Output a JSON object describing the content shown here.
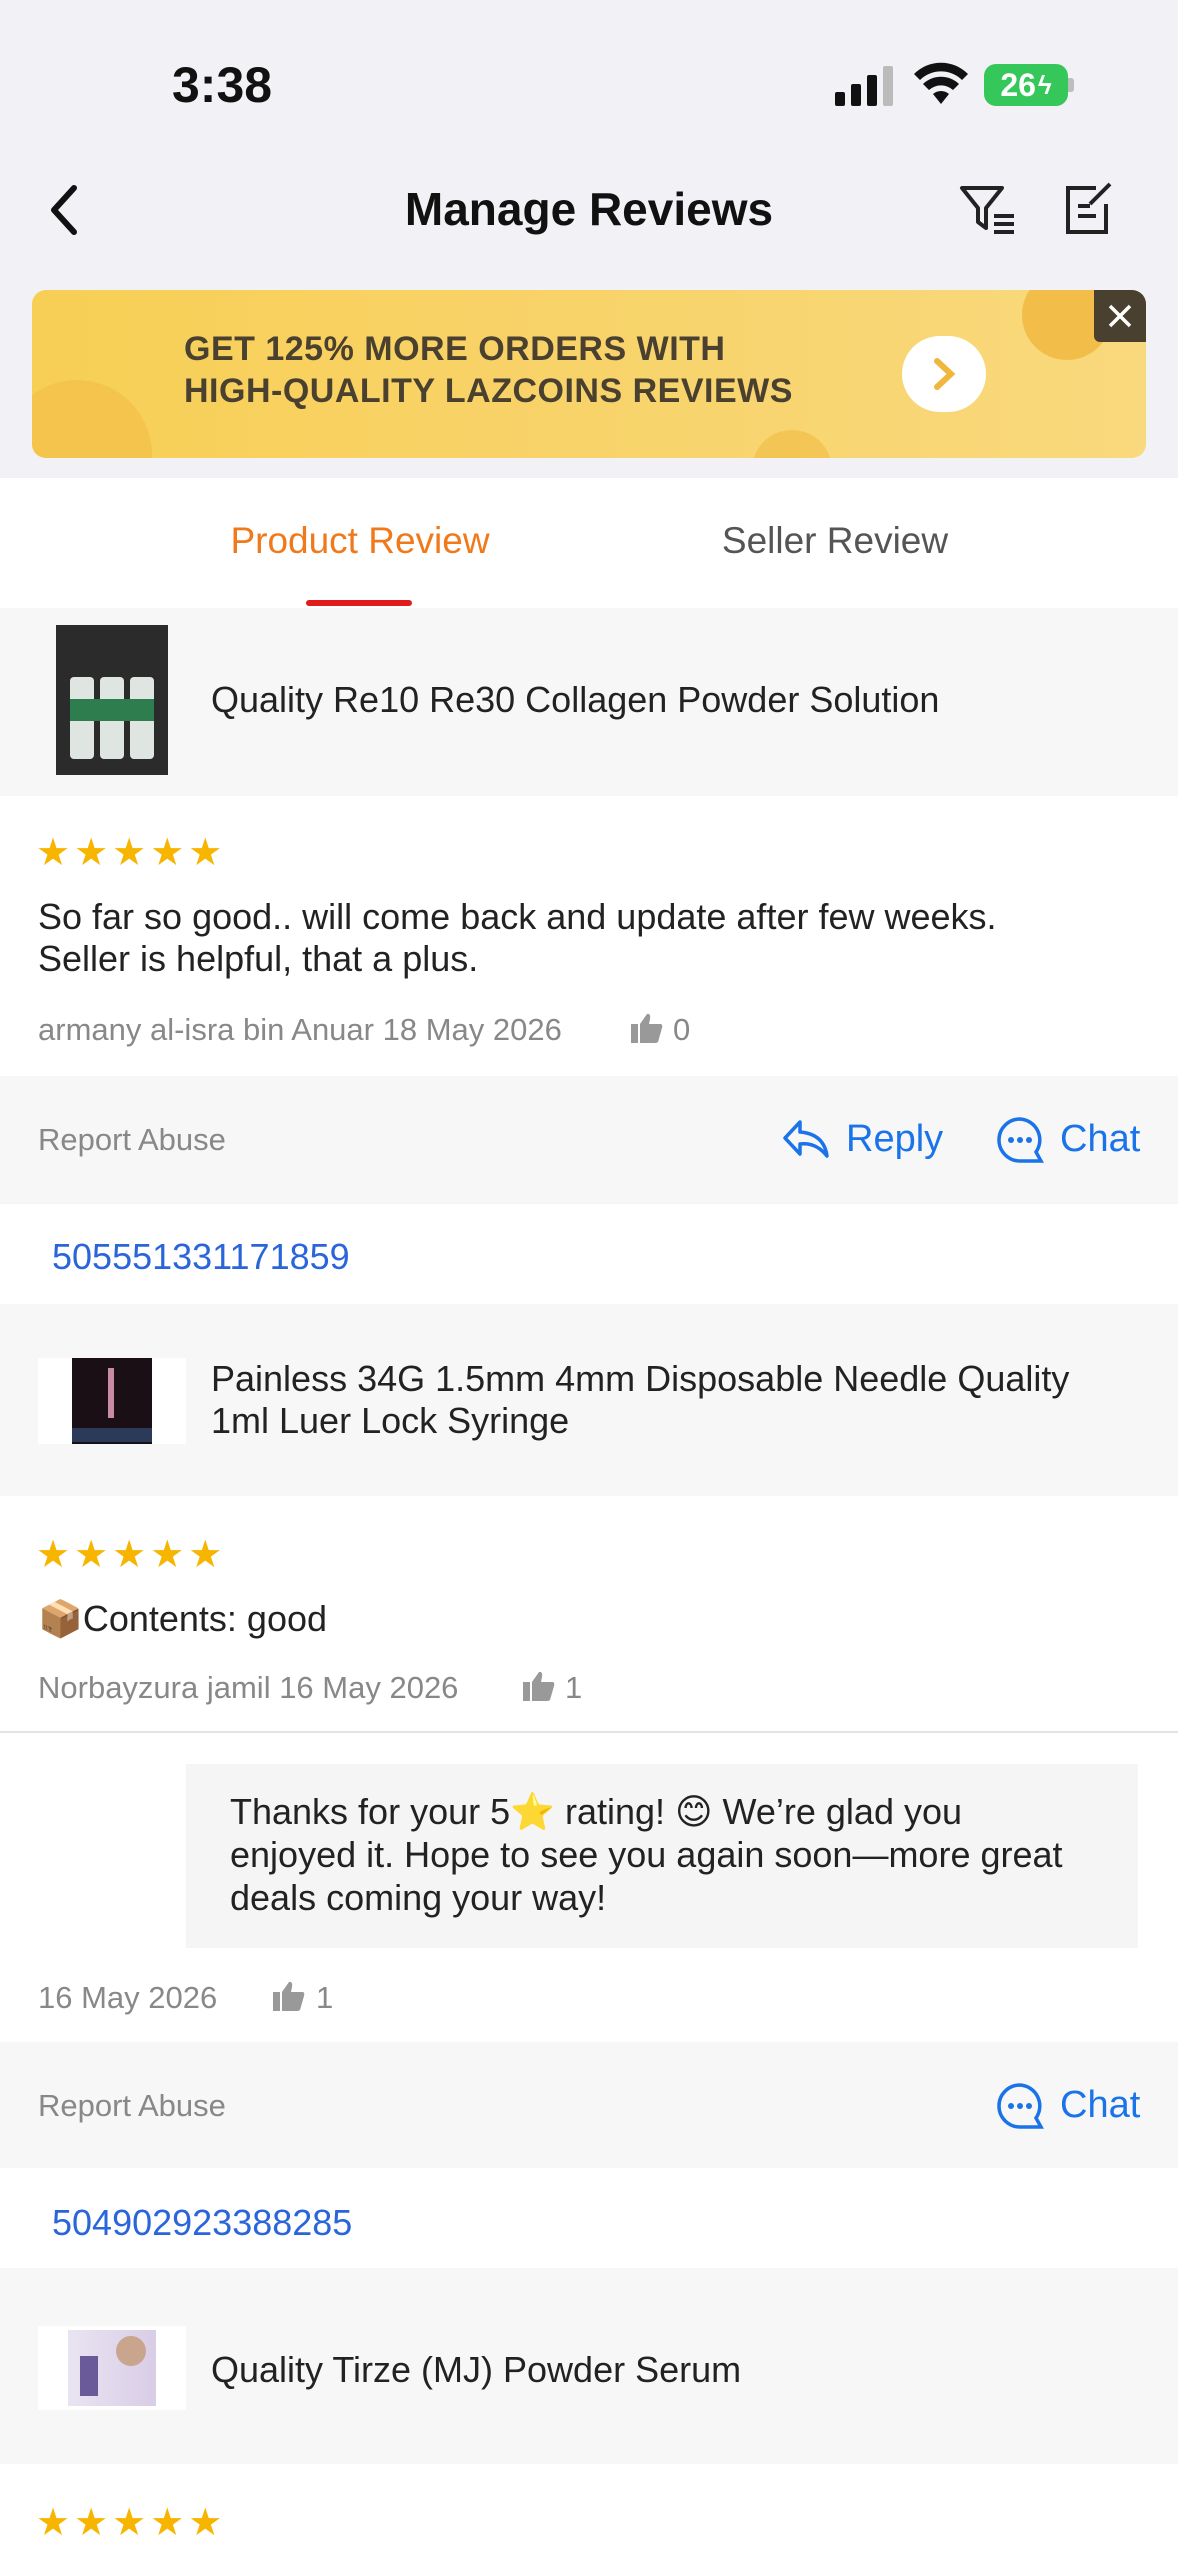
{
  "status": {
    "time": "3:38",
    "battery": "26"
  },
  "header": {
    "title": "Manage Reviews"
  },
  "banner": {
    "line1": "GET 125% MORE ORDERS WITH",
    "line2": "HIGH-QUALITY LAZCOINS REVIEWS"
  },
  "tabs": [
    {
      "label": "Product Review",
      "active": true
    },
    {
      "label": "Seller Review",
      "active": false
    }
  ],
  "reviews": [
    {
      "product": "Quality Re10 Re30 Collagen Powder Solution",
      "stars": "★★★★★",
      "text_line1": "So far so good.. will come back and update after few weeks.",
      "text_line2": "Seller is helpful, that a plus.",
      "author_date": "armany al-isra bin Anuar 18 May 2026",
      "likes": "0"
    },
    {
      "order_id": "505551331171859",
      "product_line1": "Painless 34G 1.5mm 4mm Disposable Needle Quality",
      "product_line2": "1ml Luer Lock Syringe",
      "stars": "★★★★★",
      "contents": "📦Contents:  good",
      "author_date": "Norbayzura jamil 16 May 2026",
      "likes": "1",
      "reply": {
        "line1": "Thanks for your 5⭐ rating! 😊 We’re glad you",
        "line2": "enjoyed it. Hope to see you again soon—more great",
        "line3": "deals coming your way!",
        "date": "16 May 2026",
        "likes": "1"
      }
    },
    {
      "order_id": "504902923388285",
      "product": "Quality Tirze (MJ)  Powder Serum",
      "stars": "★★★★★"
    }
  ],
  "actions": {
    "report": "Report Abuse",
    "reply": "Reply",
    "chat": "Chat"
  },
  "colors": {
    "accent_orange": "#f07a1b",
    "link_blue": "#1a73e8",
    "star": "#f7b500",
    "tab_underline": "#e11b1b"
  }
}
